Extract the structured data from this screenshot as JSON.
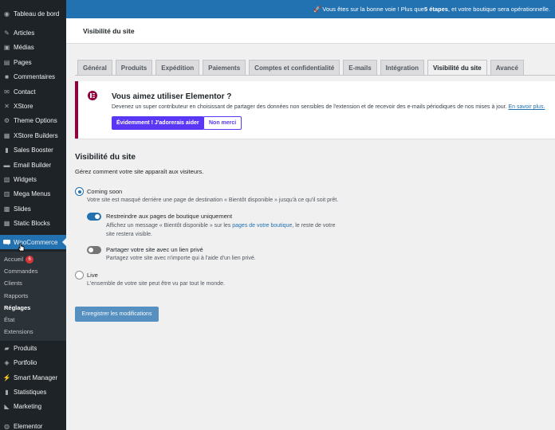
{
  "sidebar": {
    "items": [
      {
        "label": "Tableau de bord",
        "icon": "dashboard-icon"
      },
      {
        "label": "Articles",
        "icon": "pin-icon"
      },
      {
        "label": "Médias",
        "icon": "media-icon"
      },
      {
        "label": "Pages",
        "icon": "page-icon"
      },
      {
        "label": "Commentaires",
        "icon": "comment-icon"
      },
      {
        "label": "Contact",
        "icon": "mail-icon"
      },
      {
        "label": "XStore",
        "icon": "xstore-icon"
      },
      {
        "label": "Theme Options",
        "icon": "settings-icon"
      },
      {
        "label": "XStore Builders",
        "icon": "builder-icon"
      },
      {
        "label": "Sales Booster",
        "icon": "chart-icon"
      },
      {
        "label": "Email Builder",
        "icon": "email-icon"
      },
      {
        "label": "Widgets",
        "icon": "widget-icon"
      },
      {
        "label": "Mega Menus",
        "icon": "menu-icon"
      },
      {
        "label": "Slides",
        "icon": "slides-icon"
      },
      {
        "label": "Static Blocks",
        "icon": "blocks-icon"
      }
    ],
    "woocommerce": {
      "label": "WooCommerce",
      "icon": "woocommerce-icon"
    },
    "submenu": [
      {
        "label": "Accueil",
        "badge": "6"
      },
      {
        "label": "Commandes"
      },
      {
        "label": "Clients"
      },
      {
        "label": "Rapports"
      },
      {
        "label": "Réglages",
        "current": true
      },
      {
        "label": "État"
      },
      {
        "label": "Extensions"
      }
    ],
    "bottom_items": [
      {
        "label": "Produits",
        "icon": "products-icon"
      },
      {
        "label": "Portfolio",
        "icon": "portfolio-icon"
      },
      {
        "label": "Smart Manager",
        "icon": "manager-icon"
      },
      {
        "label": "Statistiques",
        "icon": "stats-icon"
      },
      {
        "label": "Marketing",
        "icon": "megaphone-icon"
      },
      {
        "label": "Elementor",
        "icon": "elementor-icon"
      }
    ]
  },
  "topbar": {
    "prefix": "🚀 Vous êtes sur la bonne voie ! Plus que ",
    "bold": "5 étapes",
    "suffix": ", et votre boutique sera opérationnelle."
  },
  "header": {
    "title": "Visibilité du site"
  },
  "tabs": [
    {
      "label": "Général",
      "active": false
    },
    {
      "label": "Produits",
      "active": false
    },
    {
      "label": "Expédition",
      "active": false
    },
    {
      "label": "Paiements",
      "active": false
    },
    {
      "label": "Comptes et confidentialité",
      "active": false
    },
    {
      "label": "E-mails",
      "active": false
    },
    {
      "label": "Intégration",
      "active": false
    },
    {
      "label": "Visibilité du site",
      "active": true
    },
    {
      "label": "Avancé",
      "active": false
    }
  ],
  "notice": {
    "title": "Vous aimez utiliser Elementor ?",
    "text": "Devenez un super contributeur en choisissant de partager des données non sensibles de l'extension et de recevoir des e-mails périodiques de nos mises à jour.",
    "link": "En savoir plus.",
    "yes_button": "Évidemment ! J'adorerais aider",
    "no_button": "Non merci"
  },
  "section": {
    "title": "Visibilité du site",
    "description": "Gérez comment votre site apparaît aux visiteurs.",
    "coming_soon": {
      "label": "Coming soon",
      "help": "Votre site est masqué derrière une page de destination « Bientôt disponible » jusqu'à ce qu'il soit prêt."
    },
    "restrict": {
      "label": "Restreindre aux pages de boutique uniquement",
      "help_prefix": "Affichez un message « Bientôt disponible » sur les ",
      "help_link": "pages de votre boutique",
      "help_suffix": ", le reste de votre",
      "help_line2": "site restera visible.",
      "enabled": true
    },
    "share": {
      "label": "Partager votre site avec un lien privé",
      "help": "Partagez votre site avec n'importe qui à l'aide d'un lien privé.",
      "enabled": false
    },
    "live": {
      "label": "Live",
      "help": "L'ensemble de votre site peut être vu par tout le monde."
    },
    "selected": "coming_soon"
  },
  "save_button": "Enregistrer les modifications"
}
